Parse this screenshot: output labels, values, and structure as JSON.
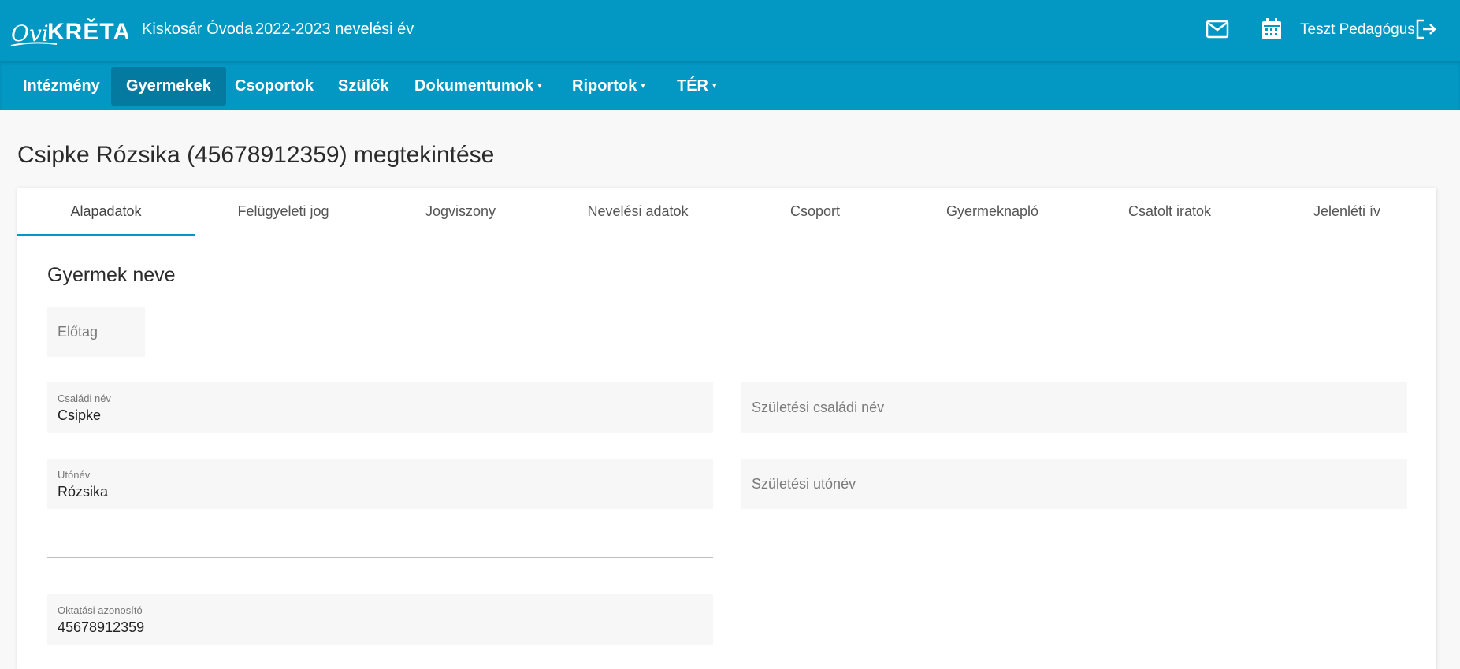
{
  "header": {
    "logo_text": "OviKRÉTA",
    "institution": "Kiskosár Óvoda",
    "school_year": "2022-2023 nevelési év",
    "user_name": "Teszt Pedagógus",
    "icons": [
      "mail-icon",
      "calendar-icon",
      "logout-icon"
    ]
  },
  "nav": {
    "items": [
      {
        "label": "Intézmény"
      },
      {
        "label": "Gyermekek",
        "active": true
      },
      {
        "label": "Csoportok"
      },
      {
        "label": "Szülők"
      },
      {
        "label": "Dokumentumok",
        "dropdown": true
      },
      {
        "label": "Riportok",
        "dropdown": true
      },
      {
        "label": "TÉR",
        "dropdown": true
      }
    ],
    "caret": "▾"
  },
  "page": {
    "title": "Csipke Rózsika (45678912359) megtekintése"
  },
  "tabs": [
    {
      "label": "Alapadatok",
      "active": true
    },
    {
      "label": "Felügyeleti jog"
    },
    {
      "label": "Jogviszony"
    },
    {
      "label": "Nevelési adatok"
    },
    {
      "label": "Csoport"
    },
    {
      "label": "Gyermeknapló"
    },
    {
      "label": "Csatolt iratok"
    },
    {
      "label": "Jelenléti ív"
    }
  ],
  "form": {
    "section_title": "Gyermek neve",
    "prefix": {
      "placeholder": "Előtag"
    },
    "family_name": {
      "label": "Családi név",
      "value": "Csipke"
    },
    "birth_family_name": {
      "placeholder": "Születési családi név"
    },
    "first_name": {
      "label": "Utónév",
      "value": "Rózsika"
    },
    "birth_first_name": {
      "placeholder": "Születési utónév"
    },
    "education_id": {
      "label": "Oktatási azonosító",
      "value": "45678912359"
    }
  },
  "colors": {
    "primary": "#0398c4",
    "nav_active": "#047aa0",
    "field_bg": "#f7f7f7"
  }
}
